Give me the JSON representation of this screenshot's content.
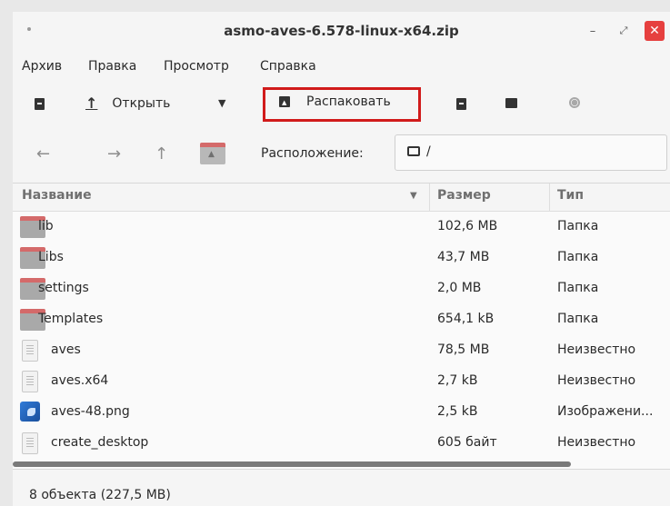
{
  "window": {
    "title": "asmo-aves-6.578-linux-x64.zip",
    "minimize": "–",
    "maximize": "⤢",
    "close": "✕"
  },
  "menu": [
    "Архив",
    "Правка",
    "Просмотр",
    "Справка"
  ],
  "toolbar": {
    "open_label": "Открыть",
    "extract_label": "Распаковать",
    "highlight_color": "#d11b1b"
  },
  "location": {
    "label": "Расположение:",
    "path": "/"
  },
  "list": {
    "columns": [
      "Название",
      "Размер",
      "Тип"
    ],
    "rows": [
      {
        "icon": "folder-icon",
        "name": "lib",
        "size": "102,6 MB",
        "type": "Папка"
      },
      {
        "icon": "folder-icon",
        "name": "Libs",
        "size": "43,7 MB",
        "type": "Папка"
      },
      {
        "icon": "folder-icon",
        "name": "settings",
        "size": "2,0 MB",
        "type": "Папка"
      },
      {
        "icon": "folder-icon",
        "name": "Templates",
        "size": "654,1 kB",
        "type": "Папка"
      },
      {
        "icon": "file-icon",
        "name": "aves",
        "size": "78,5 MB",
        "type": "Неизвестно"
      },
      {
        "icon": "file-icon",
        "name": "aves.x64",
        "size": "2,7 kB",
        "type": "Неизвестно"
      },
      {
        "icon": "image-icon",
        "name": "aves-48.png",
        "size": "2,5 kB",
        "type": "Изображени..."
      },
      {
        "icon": "file-icon",
        "name": "create_desktop",
        "size": "605 байт",
        "type": "Неизвестно"
      }
    ]
  },
  "status": "8 объекта (227,5 MB)"
}
